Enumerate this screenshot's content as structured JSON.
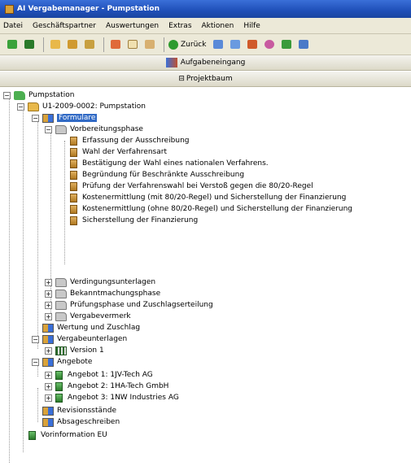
{
  "window": {
    "title": "AI Vergabemanager - Pumpstation"
  },
  "menu": [
    "Datei",
    "Geschäftspartner",
    "Auswertungen",
    "Extras",
    "Aktionen",
    "Hilfe"
  ],
  "toolbar": {
    "back_label": "Zurück"
  },
  "panels": {
    "tasks": "Aufgabeneingang",
    "project_tree": "Projektbaum"
  },
  "tree": {
    "root": "Pumpstation",
    "project": "U1-2009-0002: Pumpstation",
    "formulare": "Formulare",
    "vorbereitung": "Vorbereitungsphase",
    "vorbereitung_items": [
      "Erfassung der Ausschreibung",
      "Wahl der Verfahrensart",
      "Bestätigung der Wahl eines nationalen Verfahrens.",
      "Begründung für Beschränkte Ausschreibung",
      "Prüfung der Verfahrenswahl bei Verstoß gegen die 80/20-Regel",
      "Kostenermittlung (mit 80/20-Regel) und Sicherstellung der Finanzierung",
      "Kostenermittlung (ohne 80/20-Regel) und Sicherstellung der Finanzierung",
      "Sicherstellung der Finanzierung"
    ],
    "phases": [
      "Verdingungsunterlagen",
      "Bekanntmachungsphase",
      "Prüfungsphase und Zuschlagserteilung",
      "Vergabevermerk"
    ],
    "wertung": "Wertung und Zuschlag",
    "vergabeunterlagen": "Vergabeunterlagen",
    "version": "Version 1",
    "angebote": "Angebote",
    "angebote_items": [
      "Angebot 1: 1JV-Tech AG",
      "Angebot 2: 1HA-Tech GmbH",
      "Angebot 3: 1NW Industries AG"
    ],
    "revisionsstaende": "Revisionsstände",
    "absageschreiben": "Absageschreiben",
    "vorinformation": "Vorinformation EU"
  }
}
